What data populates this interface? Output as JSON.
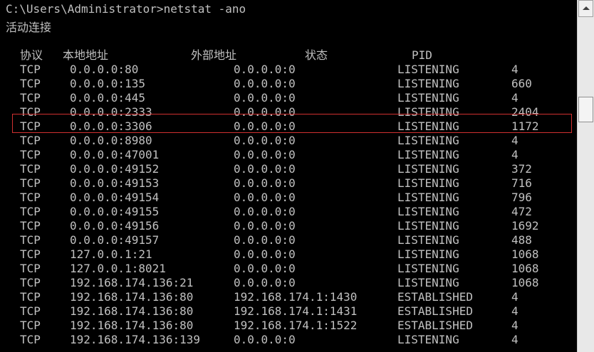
{
  "prompt": {
    "path": "C:\\Users\\Administrator>",
    "command": "netstat -ano"
  },
  "section_title": "活动连接",
  "headers": {
    "proto": "协议",
    "local": "本地地址",
    "foreign": "外部地址",
    "state": "状态",
    "pid": "PID"
  },
  "rows": [
    {
      "proto": "TCP",
      "local": "0.0.0.0:80",
      "foreign": "0.0.0.0:0",
      "state": "LISTENING",
      "pid": "4"
    },
    {
      "proto": "TCP",
      "local": "0.0.0.0:135",
      "foreign": "0.0.0.0:0",
      "state": "LISTENING",
      "pid": "660"
    },
    {
      "proto": "TCP",
      "local": "0.0.0.0:445",
      "foreign": "0.0.0.0:0",
      "state": "LISTENING",
      "pid": "4"
    },
    {
      "proto": "TCP",
      "local": "0.0.0.0:2333",
      "foreign": "0.0.0.0:0",
      "state": "LISTENING",
      "pid": "2404"
    },
    {
      "proto": "TCP",
      "local": "0.0.0.0:3306",
      "foreign": "0.0.0.0:0",
      "state": "LISTENING",
      "pid": "1172"
    },
    {
      "proto": "TCP",
      "local": "0.0.0.0:8980",
      "foreign": "0.0.0.0:0",
      "state": "LISTENING",
      "pid": "4"
    },
    {
      "proto": "TCP",
      "local": "0.0.0.0:47001",
      "foreign": "0.0.0.0:0",
      "state": "LISTENING",
      "pid": "4"
    },
    {
      "proto": "TCP",
      "local": "0.0.0.0:49152",
      "foreign": "0.0.0.0:0",
      "state": "LISTENING",
      "pid": "372"
    },
    {
      "proto": "TCP",
      "local": "0.0.0.0:49153",
      "foreign": "0.0.0.0:0",
      "state": "LISTENING",
      "pid": "716"
    },
    {
      "proto": "TCP",
      "local": "0.0.0.0:49154",
      "foreign": "0.0.0.0:0",
      "state": "LISTENING",
      "pid": "796"
    },
    {
      "proto": "TCP",
      "local": "0.0.0.0:49155",
      "foreign": "0.0.0.0:0",
      "state": "LISTENING",
      "pid": "472"
    },
    {
      "proto": "TCP",
      "local": "0.0.0.0:49156",
      "foreign": "0.0.0.0:0",
      "state": "LISTENING",
      "pid": "1692"
    },
    {
      "proto": "TCP",
      "local": "0.0.0.0:49157",
      "foreign": "0.0.0.0:0",
      "state": "LISTENING",
      "pid": "488"
    },
    {
      "proto": "TCP",
      "local": "127.0.0.1:21",
      "foreign": "0.0.0.0:0",
      "state": "LISTENING",
      "pid": "1068"
    },
    {
      "proto": "TCP",
      "local": "127.0.0.1:8021",
      "foreign": "0.0.0.0:0",
      "state": "LISTENING",
      "pid": "1068"
    },
    {
      "proto": "TCP",
      "local": "192.168.174.136:21",
      "foreign": "0.0.0.0:0",
      "state": "LISTENING",
      "pid": "1068"
    },
    {
      "proto": "TCP",
      "local": "192.168.174.136:80",
      "foreign": "192.168.174.1:1430",
      "state": "ESTABLISHED",
      "pid": "4"
    },
    {
      "proto": "TCP",
      "local": "192.168.174.136:80",
      "foreign": "192.168.174.1:1431",
      "state": "ESTABLISHED",
      "pid": "4"
    },
    {
      "proto": "TCP",
      "local": "192.168.174.136:80",
      "foreign": "192.168.174.1:1522",
      "state": "ESTABLISHED",
      "pid": "4"
    },
    {
      "proto": "TCP",
      "local": "192.168.174.136:139",
      "foreign": "0.0.0.0:0",
      "state": "LISTENING",
      "pid": "4"
    }
  ],
  "highlighted_row_index": 3,
  "colors": {
    "background": "#000000",
    "text": "#c0c0c0",
    "highlight_border": "#d03030"
  }
}
